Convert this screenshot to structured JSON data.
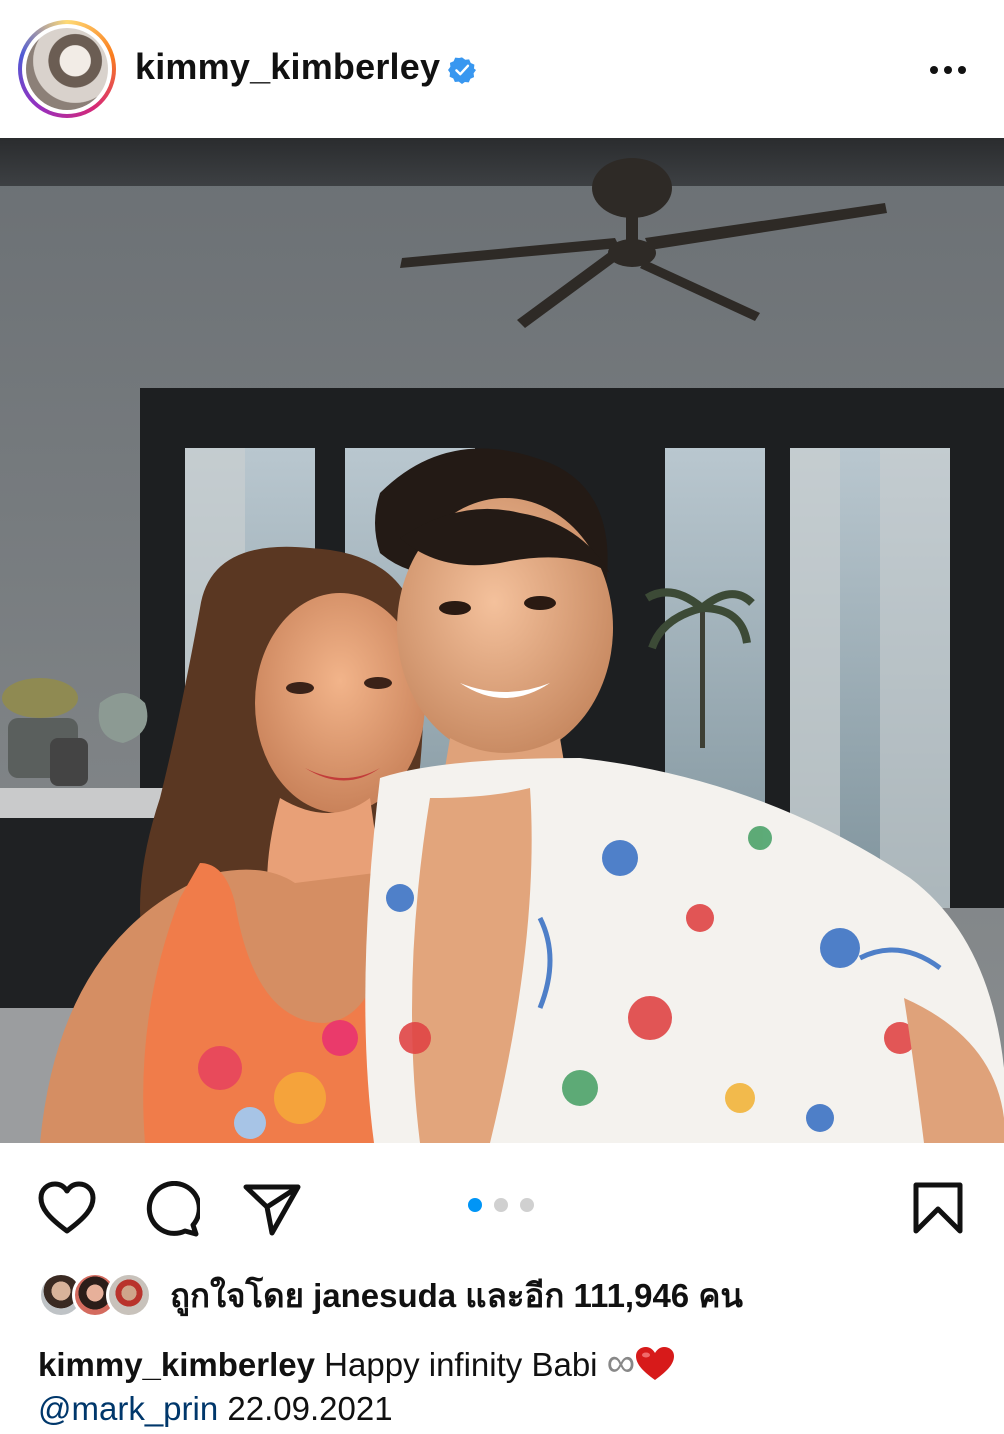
{
  "post": {
    "username": "kimmy_kimberley",
    "verified": true,
    "more_icon": "more-horizontal-icon"
  },
  "actions": {
    "like_icon": "heart-outline-icon",
    "comment_icon": "comment-icon",
    "share_icon": "send-icon",
    "save_icon": "bookmark-icon",
    "carousel": {
      "count": 3,
      "active_index": 0
    }
  },
  "likes": {
    "prefix": "ถูกใจโดย ",
    "first_liker": "janesuda",
    "suffix": " และอีก ",
    "count": "111,946",
    "unit": " คน"
  },
  "caption": {
    "username": "kimmy_kimberley",
    "text": " Happy infinity Babi ",
    "infinity_symbol": "∞",
    "mention": "@mark_prin",
    "date": " 22.09.2021"
  },
  "colors": {
    "accent_blue": "#0095f6",
    "mention_blue": "#00376b",
    "verified_blue": "#3897f0",
    "heart_red": "#d71a1a"
  }
}
